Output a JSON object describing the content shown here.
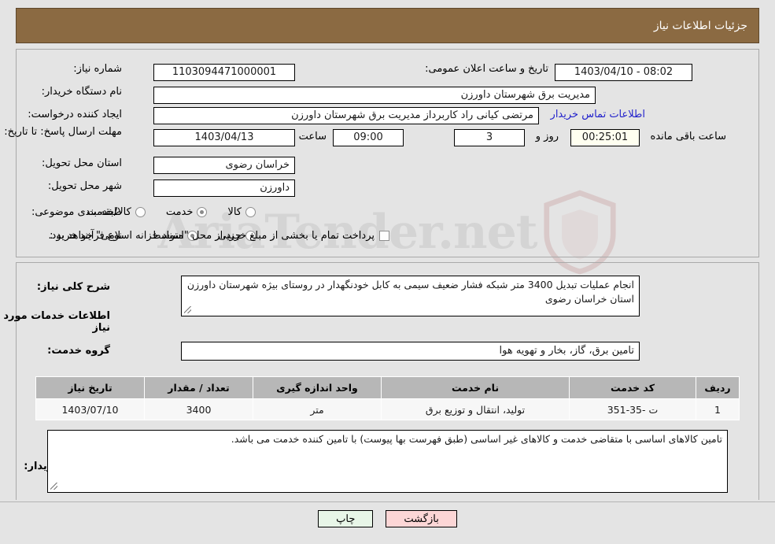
{
  "header": {
    "title": "جزئیات اطلاعات نیاز"
  },
  "watermark": {
    "text": "AriaTender.net"
  },
  "form": {
    "need_number_label": "شماره نیاز:",
    "need_number_value": "1103094471000001",
    "announce_label": "تاریخ و ساعت اعلان عمومی:",
    "announce_value": "08:02 - 1403/04/10",
    "buyer_org_label": "نام دستگاه خریدار:",
    "buyer_org_value": "مدیریت برق شهرستان داورزن",
    "creator_label": "ایجاد کننده درخواست:",
    "creator_value": "مرتضی کیانی راد کاربرداز مدیریت برق شهرستان داورزن",
    "contact_link": "اطلاعات تماس خریدار",
    "deadline_label": "مهلت ارسال پاسخ: تا تاریخ:",
    "deadline_date": "1403/04/13",
    "hour_label": "ساعت",
    "hour_value": "09:00",
    "days_value": "3",
    "days_suffix": "روز و",
    "timer_value": "00:25:01",
    "timer_suffix": "ساعت باقی مانده",
    "province_label": "استان محل تحویل:",
    "province_value": "خراسان رضوی",
    "city_label": "شهر محل تحویل:",
    "city_value": "داورزن",
    "category_label": "طبقه بندی موضوعی:",
    "category_options": [
      {
        "label": "کالا",
        "selected": false
      },
      {
        "label": "خدمت",
        "selected": true
      },
      {
        "label": "کالا/خدمت",
        "selected": false
      }
    ],
    "process_label": "نوع فرآیند خرید :",
    "process_options": [
      {
        "label": "جزیی",
        "selected": false
      },
      {
        "label": "متوسط",
        "selected": true
      }
    ],
    "treasury_checkbox_label": "پرداخت تمام یا بخشی از مبلغ خرید،از محل \"اسناد خزانه اسلامی\" خواهد بود.",
    "treasury_checked": false
  },
  "description": {
    "label": "شرح کلی نیاز:",
    "value": "انجام عملیات تبدیل 3400 متر شبکه فشار ضعیف سیمی به کابل خودنگهدار در روستای بیژه شهرستان داورزن استان خراسان رضوی"
  },
  "services_section": {
    "heading": "اطلاعات خدمات مورد نیاز",
    "group_label": "گروه خدمت:",
    "group_value": "تامین برق، گاز، بخار و تهویه هوا"
  },
  "table": {
    "headers": [
      "ردیف",
      "کد خدمت",
      "نام خدمت",
      "واحد اندازه گیری",
      "تعداد / مقدار",
      "تاریخ نیاز"
    ],
    "rows": [
      {
        "row_no": "1",
        "service_code": "ت -35-351",
        "service_name": "تولید، انتقال و توزیع برق",
        "unit": "متر",
        "quantity": "3400",
        "need_date": "1403/07/10"
      }
    ]
  },
  "buyer_notes": {
    "label": "توضیحات خریدار:",
    "value": "تامین کالاهای اساسی با متقاضی خدمت و کالاهای غیر اساسی (طبق فهرست بها پیوست) با تامین کننده خدمت می باشد."
  },
  "footer": {
    "print_label": "چاپ",
    "back_label": "بازگشت"
  }
}
